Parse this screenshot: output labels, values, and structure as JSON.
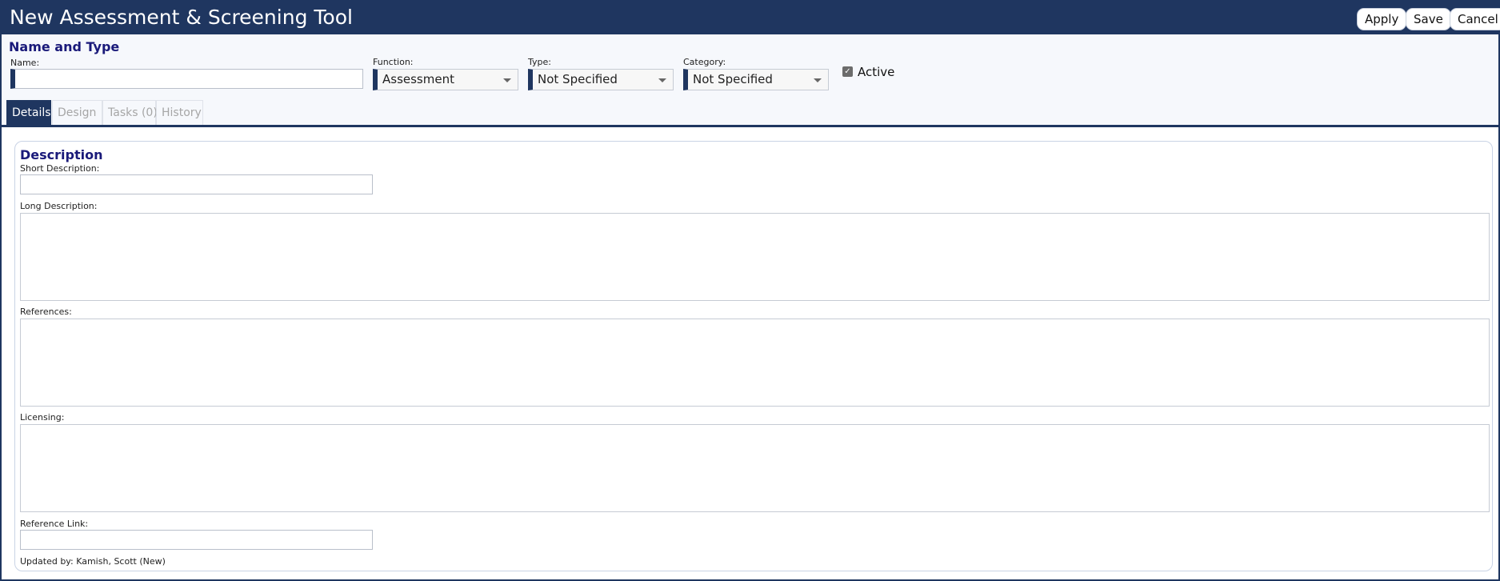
{
  "window": {
    "title": "New Assessment & Screening Tool",
    "buttons": {
      "apply": "Apply",
      "save": "Save",
      "cancel": "Cancel"
    }
  },
  "name_and_type": {
    "heading": "Name and Type",
    "name": {
      "label": "Name:",
      "value": ""
    },
    "function": {
      "label": "Function:",
      "selected": "Assessment"
    },
    "type": {
      "label": "Type:",
      "selected": "Not Specified"
    },
    "category": {
      "label": "Category:",
      "selected": "Not Specified"
    },
    "active": {
      "label": "Active",
      "checked": true
    }
  },
  "tabs": [
    {
      "label": "Details",
      "active": true
    },
    {
      "label": "Design",
      "active": false
    },
    {
      "label": "Tasks (0)",
      "active": false
    },
    {
      "label": "History",
      "active": false
    }
  ],
  "description": {
    "heading": "Description",
    "short_description": {
      "label": "Short Description:",
      "value": ""
    },
    "long_description": {
      "label": "Long Description:",
      "value": ""
    },
    "references": {
      "label": "References:",
      "value": ""
    },
    "licensing": {
      "label": "Licensing:",
      "value": ""
    },
    "reference_link": {
      "label": "Reference Link:",
      "value": ""
    },
    "updated_by": "Updated by: Kamish, Scott (New)"
  },
  "colors": {
    "brand": "#1f3660",
    "section_title": "#1a1a7a",
    "tab_inactive": "#a6a6a6"
  },
  "icons": {
    "dropdown": "chevron-down-icon",
    "checkbox": "check-icon"
  }
}
